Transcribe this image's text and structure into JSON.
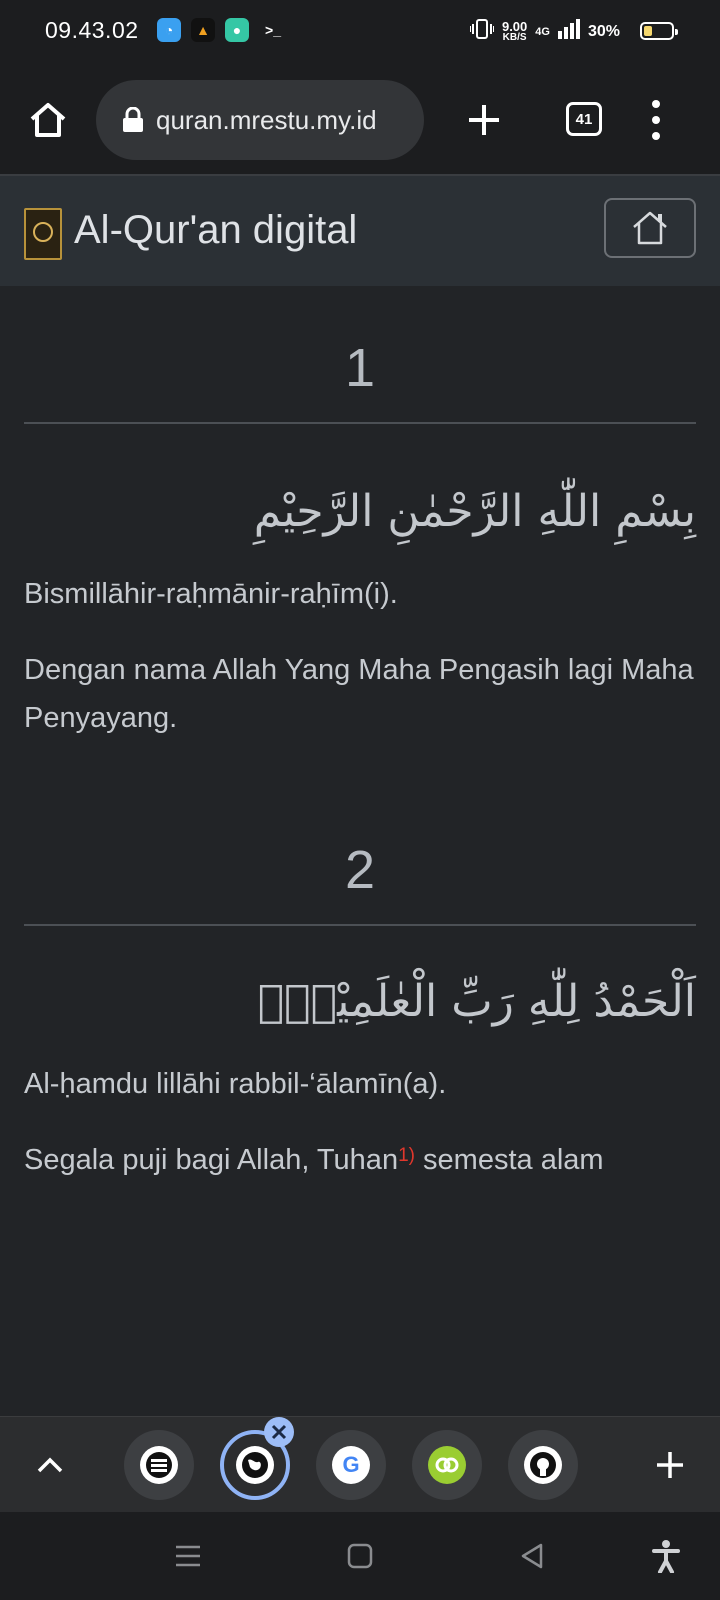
{
  "status_bar": {
    "time": "09.43.02",
    "speed_value": "9.00",
    "speed_unit": "KB/S",
    "network": "4G",
    "battery": "30%",
    "battery_level": 0.3
  },
  "browser": {
    "url": "quran.mrestu.my.id",
    "tab_count": "41"
  },
  "site": {
    "title": "Al-Qur'an digital"
  },
  "verses": [
    {
      "number": "1",
      "arabic": "بِسْمِ اللّٰهِ الرَّحْمٰنِ الرَّحِيْمِ",
      "latin": "Bismillāhir-raḥmānir-raḥīm(i).",
      "translation": "Dengan nama Allah Yang Maha Pengasih lagi Maha Penyayang."
    },
    {
      "number": "2",
      "arabic": "اَلْحَمْدُ لِلّٰهِ رَبِّ الْعٰلَمِيْنَۙ",
      "latin": "Al-ḥamdu lillāhi rabbil-‘ālamīn(a).",
      "translation_before": "Segala puji bagi Allah, Tuhan",
      "footnote": "1)",
      "translation_after": " semesta alam"
    }
  ],
  "colors": {
    "background": "#222427",
    "navbar": "#2b3035",
    "footnote": "#e0372c",
    "active_ring": "#8fb3f5"
  },
  "icons": [
    "home-icon",
    "lock-icon",
    "plus-icon",
    "tabs-icon",
    "menu-icon",
    "chevron-up-icon",
    "close-icon",
    "github-icon",
    "google-icon",
    "accessibility-icon"
  ]
}
